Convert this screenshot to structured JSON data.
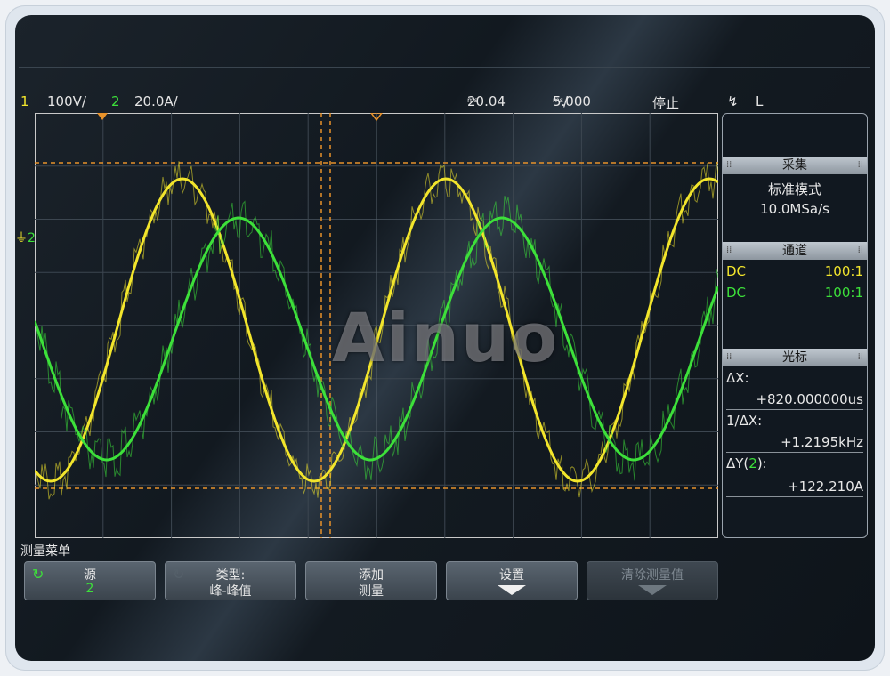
{
  "status": {
    "ch1_num": "1",
    "ch1_scale": "100V/",
    "ch2_num": "2",
    "ch2_scale": "20.0A/",
    "horiz_pos": "20.04",
    "time_scale": "5.000",
    "run_state": "停止",
    "trigger_source": "L"
  },
  "markers": {
    "ch2_ground": "2"
  },
  "sidebar": {
    "acq": {
      "title": "采集",
      "mode": "标准模式",
      "rate": "10.0MSa/s"
    },
    "channel": {
      "title": "通道",
      "rows": [
        {
          "coupling": "DC",
          "probe": "100:1"
        },
        {
          "coupling": "DC",
          "probe": "100:1"
        }
      ]
    },
    "cursor": {
      "title": "光标",
      "dx_label": "ΔX:",
      "dx_value": "+820.000000us",
      "inv_dx_label": "1/ΔX:",
      "inv_dx_value": "+1.2195kHz",
      "dy_label_a": "ΔY(",
      "dy_label_ch": "2",
      "dy_label_b": "):",
      "dy_value": "+122.210A"
    }
  },
  "menu": {
    "title": "测量菜单",
    "keys": [
      {
        "line1": "源",
        "line2": "2"
      },
      {
        "line1": "类型:",
        "line2": "峰-峰值"
      },
      {
        "line1": "添加",
        "line2": "测量"
      },
      {
        "line1": "设置"
      },
      {
        "line1": "清除测量值"
      }
    ]
  },
  "watermark": "Ainuo",
  "colors": {
    "ch1": "#f2e52c",
    "ch2": "#3de03a",
    "cursor": "#e8922a",
    "grid": "#3c4650"
  },
  "icons": {
    "cycle": "cycle-icon",
    "trigger": "trigger-edge-icon",
    "down": "arrow-down-icon"
  }
}
